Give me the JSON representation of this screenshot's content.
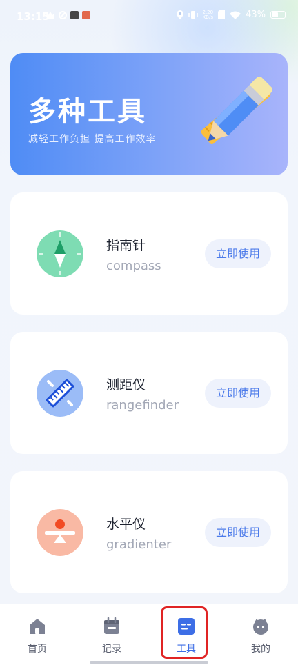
{
  "status_bar": {
    "time": "13:15",
    "net_speed_top": "2.20",
    "net_speed_bottom": "KB/s",
    "battery": "43%"
  },
  "banner": {
    "title": "多种工具",
    "subtitle": "减轻工作负担 提高工作效率"
  },
  "tools": [
    {
      "name": "指南针",
      "sub": "compass",
      "button": "立即使用",
      "icon": "compass-icon",
      "color": "#7edcb3"
    },
    {
      "name": "测距仪",
      "sub": "rangefinder",
      "button": "立即使用",
      "icon": "ruler-icon",
      "color": "#9bbcf7"
    },
    {
      "name": "水平仪",
      "sub": "gradienter",
      "button": "立即使用",
      "icon": "level-icon",
      "color": "#f9b9a4"
    }
  ],
  "tabbar": {
    "items": [
      {
        "label": "首页",
        "icon": "home-icon"
      },
      {
        "label": "记录",
        "icon": "calendar-icon"
      },
      {
        "label": "工具",
        "icon": "tools-icon",
        "active": true
      },
      {
        "label": "我的",
        "icon": "profile-icon"
      }
    ],
    "active_color": "#3d6ee6"
  }
}
